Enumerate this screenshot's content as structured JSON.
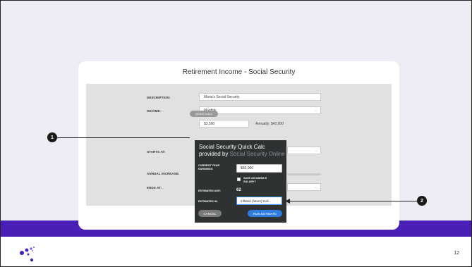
{
  "card": {
    "title": "Retirement Income - Social Security"
  },
  "form": {
    "description_label": "DESCRIPTION:",
    "description_value": "Maria's Social Security",
    "income_label": "INCOME:",
    "income_select": "Monthly",
    "amount_value": "$3,500",
    "annually_text": "Annually: $42,000",
    "quick_calc_label": "QUICK CALC",
    "starts_at_label": "STARTS AT:",
    "annual_increase_label": "ANNUAL INCREASE:",
    "ends_at_label": "ENDS AT:"
  },
  "popup": {
    "title_line1": "Social Security Quick Calc",
    "title_line2_prefix": "provided by ",
    "title_line2_brand": "Social Security Online",
    "current_year_label_1": "CURRENT YEAR",
    "current_year_label_2": "EARNINGS:",
    "earnings_value": "$50,000",
    "save_label_1": "SAVE AS MARIA'S",
    "save_label_2": "SALARY?",
    "estimated_age_label": "ESTIMATED AGE:",
    "estimated_age_value": "62",
    "estimated_in_label": "ESTIMATED IN:",
    "estimated_in_value": "Inflated (future) Doll...",
    "cancel_label": "CANCEL",
    "run_label": "RUN ESTIMATE"
  },
  "callouts": [
    "1",
    "2"
  ],
  "page_number": "12",
  "colors": {
    "brand_purple": "#4a1fb5",
    "popup_bg": "#2f3233",
    "primary_button": "#2f7de1"
  }
}
